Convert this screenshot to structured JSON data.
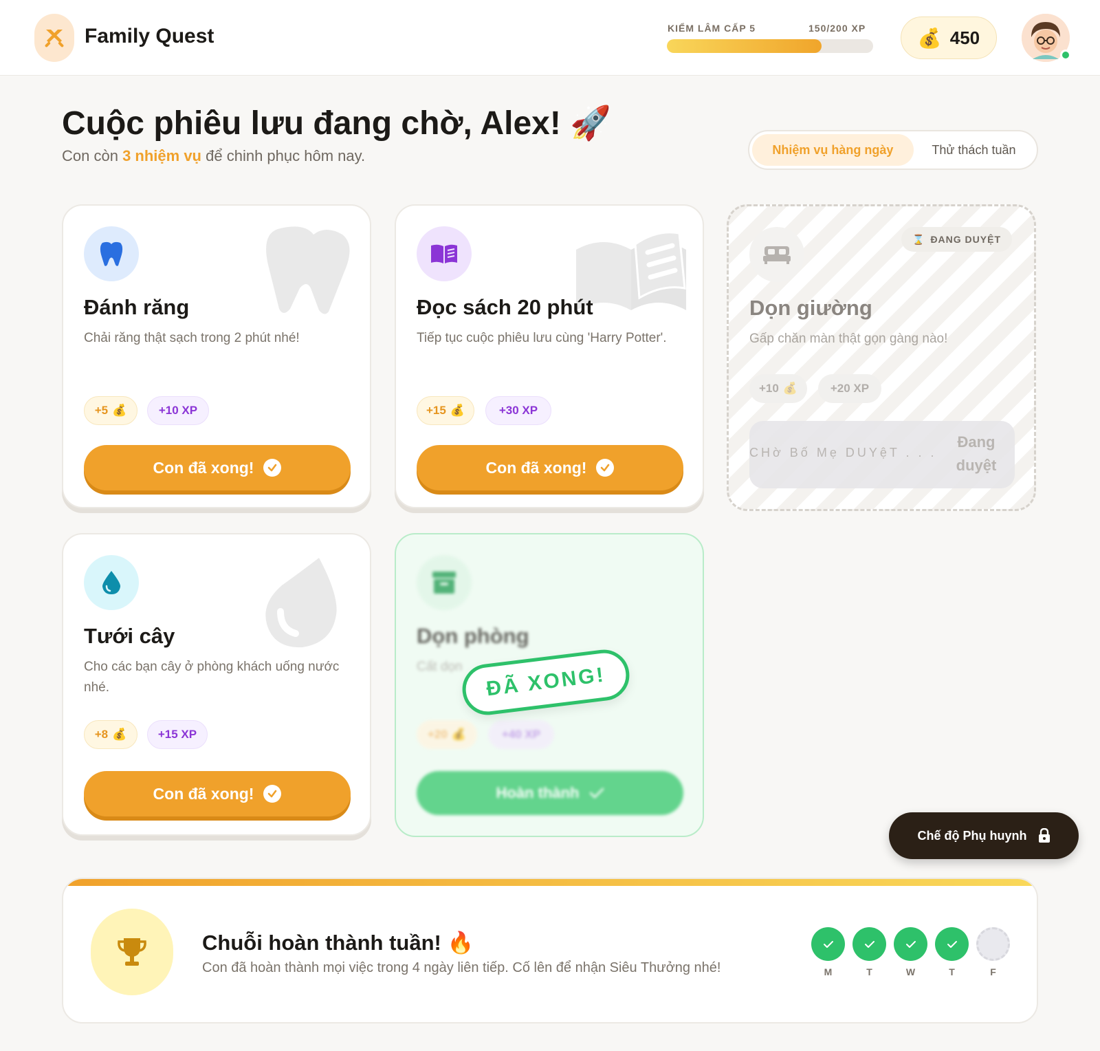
{
  "header": {
    "app_title": "Family Quest",
    "level_label": "KIỂM LÂM CẤP 5",
    "xp_label": "150/200 XP",
    "xp_progress": 0.75,
    "coins": "450"
  },
  "hero": {
    "title": "Cuộc phiêu lưu đang chờ, Alex! 🚀",
    "sub_prefix": "Con còn",
    "sub_highlight": "3 nhiệm vụ",
    "sub_suffix": "để chinh phục hôm nay."
  },
  "tabs": [
    {
      "label": "Nhiệm vụ hàng ngày",
      "active": true
    },
    {
      "label": "Thử thách tuần",
      "active": false
    }
  ],
  "tasks": [
    {
      "title": "Đánh răng",
      "desc": "Chải răng thật sạch trong 2 phút nhé!",
      "coins": "+5",
      "xp": "+10 XP",
      "button": "Con đã xong!",
      "icon": "tooth-icon"
    },
    {
      "title": "Đọc sách 20 phút",
      "desc": "Tiếp tục cuộc phiêu lưu cùng 'Harry Potter'.",
      "coins": "+15",
      "xp": "+30 XP",
      "button": "Con đã xong!",
      "icon": "book-icon"
    },
    {
      "title": "Dọn giường",
      "desc": "Gấp chăn màn thật gọn gàng nào!",
      "coins": "+10",
      "xp": "+20 XP",
      "badge": "ĐANG DUYỆT",
      "waiting": "CHờ Bố Mẹ DUYệT . . .",
      "status": "Đang duyệt",
      "icon": "bed-icon"
    },
    {
      "title": "Tưới cây",
      "desc": "Cho các bạn cây ở phòng khách uống nước nhé.",
      "coins": "+8",
      "xp": "+15 XP",
      "button": "Con đã xong!",
      "icon": "water-drop-icon"
    },
    {
      "title": "Dọn phòng",
      "desc": "Cất dọn",
      "coins": "+20",
      "xp": "+40 XP",
      "stamp": "ĐÃ XONG!",
      "button": "Hoàn thành",
      "icon": "archive-box-icon"
    }
  ],
  "parent_mode": {
    "label": "Chế độ Phụ huynh",
    "icon": "lock-icon"
  },
  "streak": {
    "title": "Chuỗi hoàn thành tuần! 🔥",
    "desc": "Con đã hoàn thành mọi việc trong 4 ngày liên tiếp. Cố lên để nhận Siêu Thưởng nhé!",
    "days": [
      {
        "label": "M",
        "done": true
      },
      {
        "label": "T",
        "done": true
      },
      {
        "label": "W",
        "done": true
      },
      {
        "label": "T",
        "done": true
      },
      {
        "label": "F",
        "done": false
      }
    ]
  },
  "colors": {
    "accent": "#f0a12b",
    "success": "#2ec16a",
    "xp": "#8b35d6"
  }
}
